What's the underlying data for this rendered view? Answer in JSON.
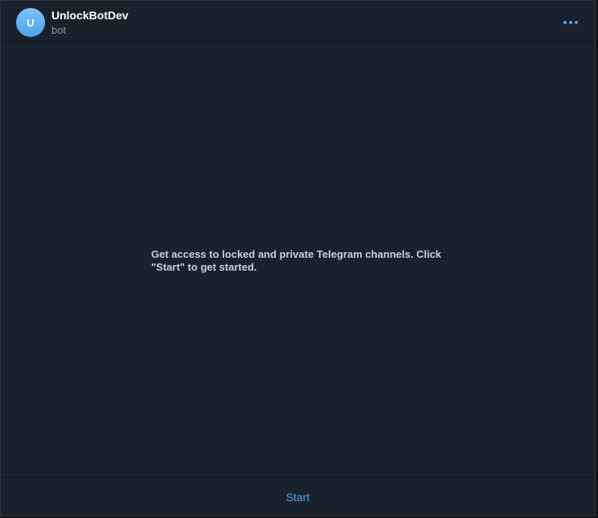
{
  "header": {
    "avatar_initial": "U",
    "title": "UnlockBotDev",
    "subtitle": "bot",
    "menu_icon": "more-horizontal-icon"
  },
  "content": {
    "info_text": "Get access to locked and private Telegram channels. Click \"Start\" to get started."
  },
  "footer": {
    "start_label": "Start"
  },
  "colors": {
    "background": "#19222c",
    "accent": "#4fa6f0",
    "title": "#ffffff",
    "subtitle": "#8a98a5",
    "body_text": "#c7d0d9"
  }
}
